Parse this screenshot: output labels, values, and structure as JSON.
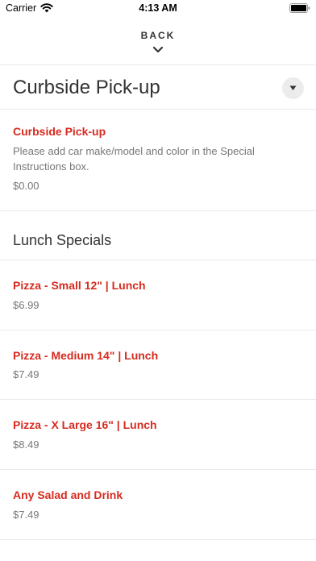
{
  "status_bar": {
    "carrier": "Carrier",
    "time": "4:13 AM"
  },
  "nav": {
    "back_label": "BACK"
  },
  "category": {
    "title": "Curbside Pick-up",
    "items": [
      {
        "name": "Curbside Pick-up",
        "description": "Please add car make/model and color in the Special Instructions box.",
        "price": "$0.00"
      }
    ]
  },
  "lunch": {
    "title": "Lunch Specials",
    "items": [
      {
        "name": "Pizza - Small 12\" | Lunch",
        "price": "$6.99"
      },
      {
        "name": "Pizza - Medium 14\" | Lunch",
        "price": "$7.49"
      },
      {
        "name": "Pizza - X Large 16\" | Lunch",
        "price": "$8.49"
      },
      {
        "name": "Any Salad and Drink",
        "price": "$7.49"
      }
    ]
  },
  "colors": {
    "accent": "#d62b1f",
    "text": "#333333",
    "muted": "#777777",
    "divider": "#e9e9e9"
  }
}
